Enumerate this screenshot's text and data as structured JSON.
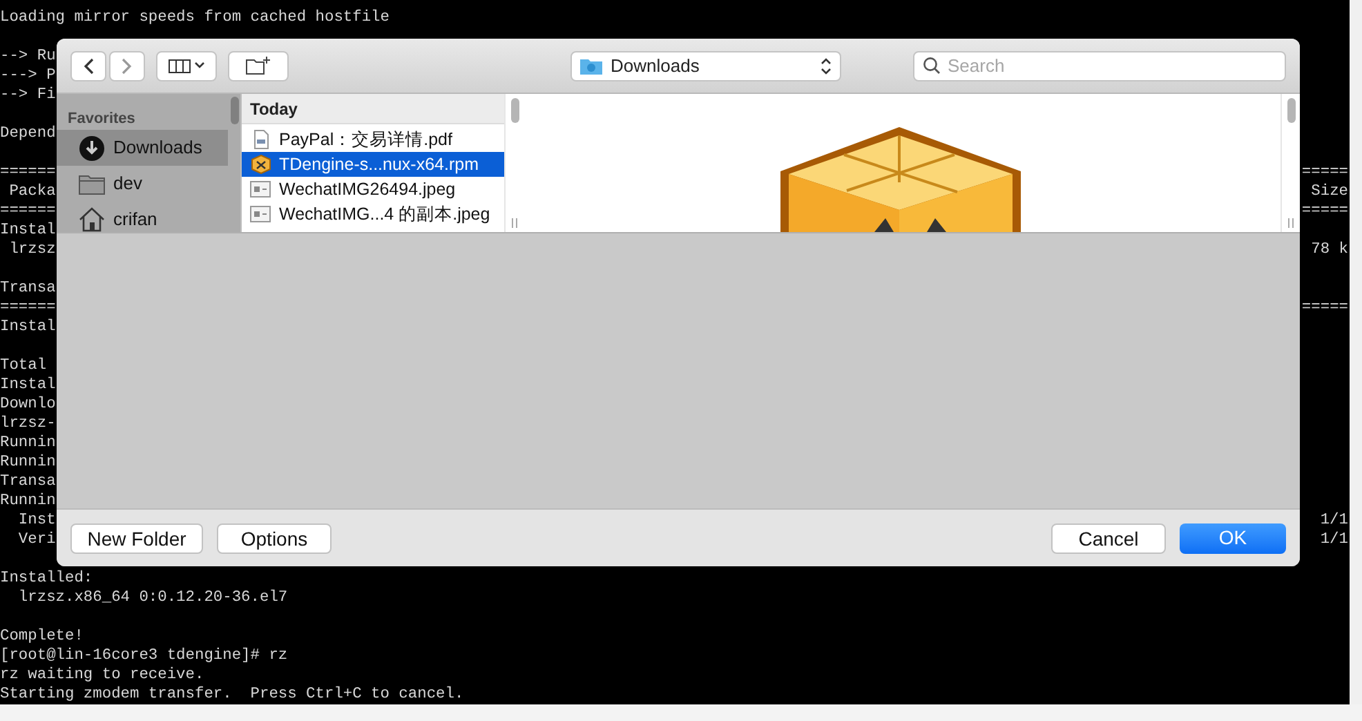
{
  "terminal": {
    "blocks": [
      [
        {
          "text": "Loading mirror speeds from cached hostfile"
        }
      ],
      [
        {
          "text": "--> Ru"
        },
        {
          "text": "---> P"
        },
        {
          "text": "--> Fi"
        }
      ],
      [
        {
          "text": "Depend"
        }
      ],
      [
        {
          "text": "======",
          "right": "====="
        },
        {
          "text": " Packa",
          "right": "Size"
        },
        {
          "text": "======",
          "right": "====="
        },
        {
          "text": "Instal"
        },
        {
          "text": " lrzsz",
          "right": "78 k"
        }
      ],
      [
        {
          "text": "Transa"
        },
        {
          "text": "======",
          "right": "====="
        },
        {
          "text": "Instal"
        }
      ],
      [
        {
          "text": "Total"
        },
        {
          "text": "Instal"
        },
        {
          "text": "Downlo"
        },
        {
          "text": "lrzsz-"
        },
        {
          "text": "Runnin"
        },
        {
          "text": "Runnin"
        },
        {
          "text": "Transa"
        },
        {
          "text": "Runnin"
        },
        {
          "text": "  Inst",
          "right": "1/1"
        },
        {
          "text": "  Veri",
          "right": "1/1"
        }
      ],
      [
        {
          "text": "Installed:"
        },
        {
          "text": "  lrzsz.x86_64 0:0.12.20-36.el7"
        }
      ],
      [
        {
          "text": "Complete!"
        },
        {
          "text": "[root@lin-16core3 tdengine]# rz"
        },
        {
          "text": "rz waiting to receive."
        },
        {
          "text": "Starting zmodem transfer.  Press Ctrl+C to cancel."
        }
      ]
    ]
  },
  "dialog": {
    "toolbar": {
      "location": "Downloads",
      "search": {
        "placeholder": "Search"
      }
    },
    "sidebar": {
      "heading": "Favorites",
      "items": [
        {
          "label": "Downloads",
          "kind": "downloads",
          "selected": true
        },
        {
          "label": "dev",
          "kind": "folder",
          "selected": false
        },
        {
          "label": "crifan",
          "kind": "home",
          "selected": false
        }
      ]
    },
    "column": {
      "heading": "Today",
      "files": [
        {
          "name": "PayPal：交易详情.pdf",
          "kind": "document",
          "selected": false
        },
        {
          "name": "TDengine-s...nux-x64.rpm",
          "kind": "package",
          "selected": true
        },
        {
          "name": "WechatIMG26494.jpeg",
          "kind": "image",
          "selected": false
        },
        {
          "name": "WechatIMG...4 的副本.jpeg",
          "kind": "image",
          "selected": false
        }
      ]
    },
    "buttons_left": [
      {
        "label": "New Folder",
        "kind": "secondary"
      },
      {
        "label": "Options",
        "kind": "secondary"
      }
    ],
    "buttons_right": [
      {
        "label": "Cancel",
        "kind": "secondary"
      },
      {
        "label": "OK",
        "kind": "primary"
      }
    ]
  }
}
